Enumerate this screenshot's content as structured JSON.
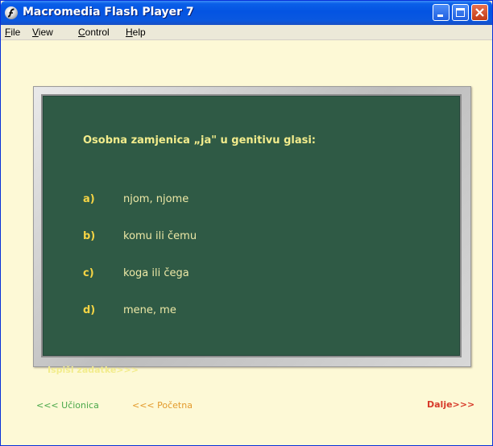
{
  "window": {
    "title": "Macromedia Flash Player 7",
    "icon": "flash-player-icon",
    "controls": [
      "minimize-icon",
      "maximize-icon",
      "close-icon"
    ]
  },
  "menubar": {
    "items": [
      {
        "underline": "F",
        "rest": "ile"
      },
      {
        "underline": "V",
        "rest": "iew"
      },
      {
        "underline": "C",
        "rest": "ontrol"
      },
      {
        "underline": "H",
        "rest": "elp"
      }
    ]
  },
  "quiz": {
    "question": "Osobna zamjenica „ja\" u genitivu glasi:",
    "options": [
      {
        "letter": "a)",
        "text": "njom, njome"
      },
      {
        "letter": "b)",
        "text": "komu ili čemu"
      },
      {
        "letter": "c)",
        "text": "koga ili čega"
      },
      {
        "letter": "d)",
        "text": "mene, me"
      }
    ],
    "print_link": "Ispiši zadatke>>>"
  },
  "navigation": {
    "classroom": "<<< Učionica",
    "home": "<<< Početna",
    "next": "Dalje>>>"
  },
  "colors": {
    "board": "#2f5a45",
    "question_text": "#f2ec8c",
    "option_letter": "#f5d445",
    "stage_background": "#fdf9d6",
    "nav_classroom": "#4aa84a",
    "nav_home": "#e39a2c",
    "nav_next": "#d73a2a"
  }
}
